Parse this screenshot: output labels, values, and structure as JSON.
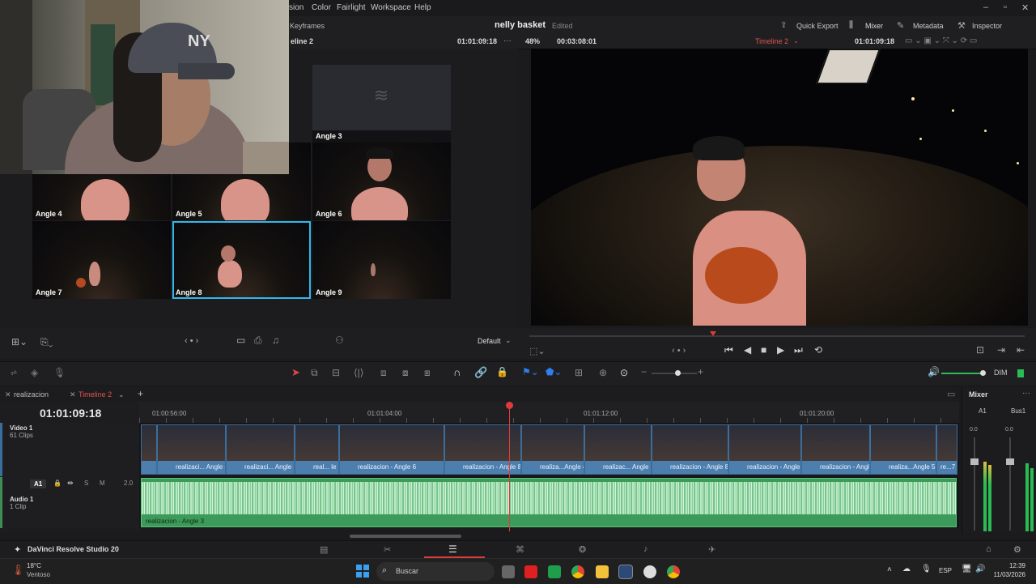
{
  "menu": {
    "items": [
      "sion",
      "Color",
      "Fairlight",
      "Workspace",
      "Help"
    ]
  },
  "toolbar": {
    "keyframes": "Keyframes",
    "project_title": "nelly basket",
    "edited": "Edited",
    "quick_export": "Quick Export",
    "mixer": "Mixer",
    "metadata": "Metadata",
    "inspector": "Inspector"
  },
  "subbar": {
    "timeline_left": "eline 2",
    "tc_left": "01:01:09:18",
    "zoom": "48%",
    "duration": "00:03:08:01",
    "timeline_name": "Timeline 2",
    "tc_right": "01:01:09:18"
  },
  "multicam": {
    "angles": [
      {
        "label": "Angle 3"
      },
      {
        "label": "Angle 4"
      },
      {
        "label": "Angle 5"
      },
      {
        "label": "Angle 6"
      },
      {
        "label": "Angle 7"
      },
      {
        "label": "Angle 8"
      },
      {
        "label": "Angle 9"
      }
    ],
    "selected": "Angle 8",
    "view_mode": "Default"
  },
  "timeline": {
    "tabs": [
      "realizacion",
      "Timeline 2"
    ],
    "active_tab": "Timeline 2",
    "timecode": "01:01:09:18",
    "ruler": [
      "01:00:56:00",
      "01:01:04:00",
      "01:01:12:00",
      "01:01:20:00"
    ],
    "video_track": {
      "name": "Video 1",
      "clips_count": "61 Clips"
    },
    "audio_track": {
      "badge": "A1",
      "name": "Audio 1",
      "clips_count": "1 Clip",
      "level": "2.0",
      "s": "S",
      "m": "M"
    },
    "video_clips": [
      "realizaci... Angle 4",
      "realizaci... Angle 5",
      "real... le 7",
      "realizacion - Angle 6",
      "realizacion - Angle 8",
      "realiza...Angle 4",
      "realizac... Angle 7",
      "realizacion - Angle 8",
      "realizacion - Angle 4",
      "realizacion - Angle 9",
      "realiza...Angle 5",
      "re...7"
    ],
    "audio_clip": "realizacion - Angle 3"
  },
  "mixer": {
    "title": "Mixer",
    "ch1": "A1",
    "ch2": "Bus1",
    "val1": "0.0",
    "val2": "0.0",
    "dim": "DIM"
  },
  "status": {
    "app": "DaVinci Resolve Studio 20"
  },
  "taskbar": {
    "temp": "18°C",
    "weather": "Ventoso",
    "search_placeholder": "Buscar",
    "lang": "ESP",
    "time": "12:39",
    "date": "11/03/2026"
  }
}
